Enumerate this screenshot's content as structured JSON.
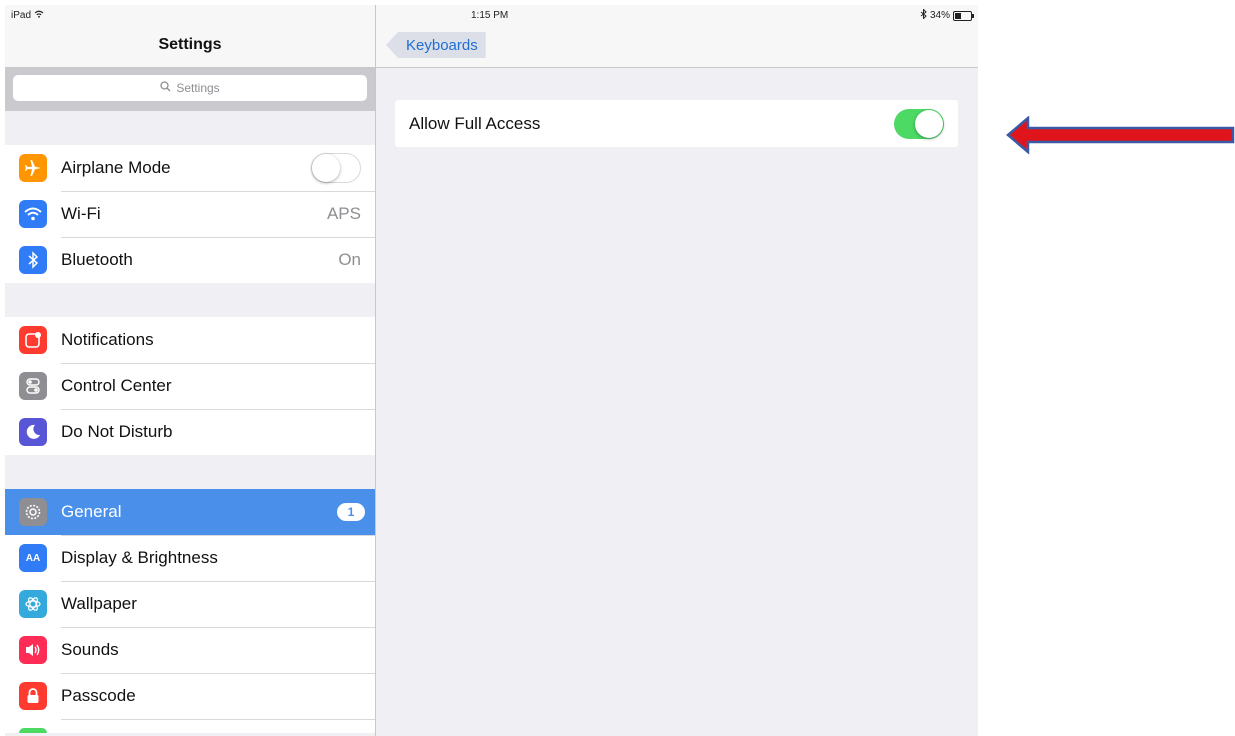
{
  "status_bar": {
    "device": "iPad",
    "time": "1:15 PM",
    "battery": "34%",
    "battery_level": 0.34
  },
  "sidebar": {
    "title": "Settings",
    "search_placeholder": "Settings",
    "groups": [
      [
        {
          "label": "Airplane Mode",
          "icon": "airplane-icon",
          "color": "#ff9500",
          "toggle": "off"
        },
        {
          "label": "Wi-Fi",
          "icon": "wifi-icon",
          "color": "#2f7cf6",
          "value": "APS"
        },
        {
          "label": "Bluetooth",
          "icon": "bluetooth-icon",
          "color": "#2f7cf6",
          "value": "On"
        }
      ],
      [
        {
          "label": "Notifications",
          "icon": "notifications-icon",
          "color": "#ff3b30"
        },
        {
          "label": "Control Center",
          "icon": "control-center-icon",
          "color": "#8e8e93"
        },
        {
          "label": "Do Not Disturb",
          "icon": "moon-icon",
          "color": "#5856d6"
        }
      ],
      [
        {
          "label": "General",
          "icon": "gear-icon",
          "color": "#8e8e93",
          "badge": "1",
          "selected": true
        },
        {
          "label": "Display & Brightness",
          "icon": "display-icon",
          "color": "#2f7cf6",
          "icon_text": "AA"
        },
        {
          "label": "Wallpaper",
          "icon": "wallpaper-icon",
          "color": "#34aadc"
        },
        {
          "label": "Sounds",
          "icon": "sound-icon",
          "color": "#ff2d55"
        },
        {
          "label": "Passcode",
          "icon": "lock-icon",
          "color": "#ff3b30"
        }
      ]
    ]
  },
  "detail": {
    "back_label": "Keyboards",
    "setting_label": "Allow Full Access",
    "setting_state": "on"
  },
  "colors": {
    "accent": "#4a90ea",
    "toggle_on": "#4cd964",
    "arrow": "#e0151b",
    "arrow_outline": "#3b5aa6"
  }
}
